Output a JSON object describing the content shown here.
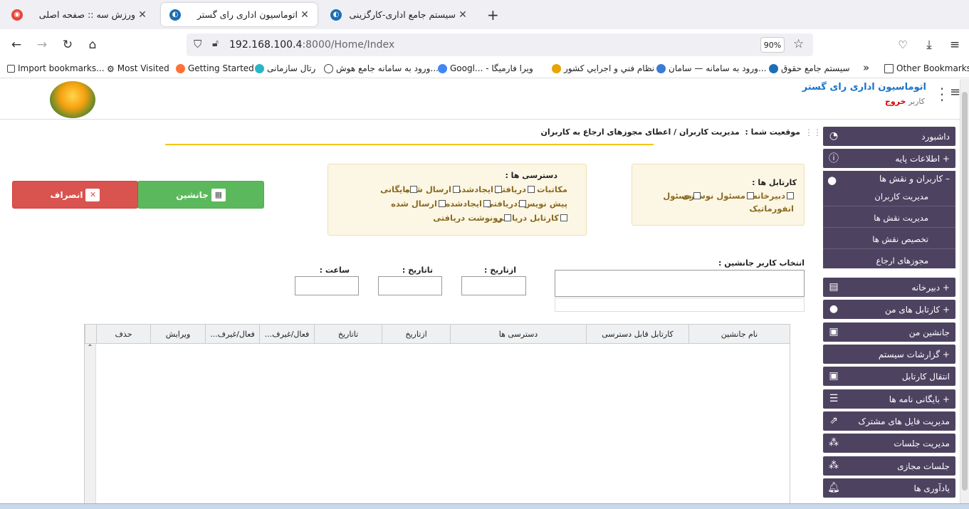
{
  "browser": {
    "tabs": [
      {
        "title": "ورزش سه :: صفحه اصلی",
        "active": false
      },
      {
        "title": "اتوماسیون اداری رای گستر",
        "active": true
      },
      {
        "title": "سیستم جامع اداری-کارگزینی",
        "active": false
      }
    ],
    "new_tab": "+",
    "url_host": "192.168.100.4",
    "url_rest": ":8000/Home/Index",
    "zoom": "90%",
    "bookmarks": [
      "Import bookmarks...",
      "Most Visited",
      "Getting Started",
      "رتال سازمانی",
      "ورود به سامانه جامع هوش...",
      "Googl... - ویرا فارمیگا",
      "نظام فني و اجرايي كشور",
      "ورود به سامانه — سامان...",
      "سیستم جامع حقوق",
      "Other Bookmarks"
    ]
  },
  "header": {
    "app_title": "اتوماسیون اداری رای گستر",
    "user_prefix": "کاربر",
    "logout": "خروج"
  },
  "sidebar": {
    "items": [
      {
        "label": "داشبورد",
        "icon": "dashboard-icon"
      },
      {
        "label": "+ اطلاعات پایه",
        "icon": "info-icon"
      },
      {
        "label": "+ دبیرخانه",
        "icon": "document-icon"
      },
      {
        "label": "+ کارتابل های من",
        "icon": "user-icon"
      },
      {
        "label": "جانشین من",
        "icon": "substitute-icon"
      },
      {
        "label": "+ گزارشات سیستم",
        "icon": ""
      },
      {
        "label": "انتقال کارتابل",
        "icon": "transfer-icon"
      },
      {
        "label": "+ بایگانی نامه ها",
        "icon": "archive-icon"
      },
      {
        "label": "مدیریت فایل های مشترک",
        "icon": "share-icon"
      },
      {
        "label": "مدیریت جلسات",
        "icon": "meeting-icon"
      },
      {
        "label": "جلسات مجازی",
        "icon": "virtual-meeting-icon"
      },
      {
        "label": "یادآوری ها",
        "icon": "bell-icon"
      }
    ],
    "group": {
      "label": "– کاربران و نقش ها",
      "subitems": [
        "مدیریت کاربران",
        "مدیریت نقش ها",
        "تخصیص نقش ها",
        "مجوزهای ارجاع"
      ]
    }
  },
  "breadcrumb": {
    "prefix": "موقعیت شما :",
    "path": "مدیریت کاربران / اعطای مجوزهای ارجاع به کاربران"
  },
  "form": {
    "kartable_title": "کارتابل ها :",
    "kartable_options": [
      "دبیرخانه",
      "مسئول نوسازی",
      "مسئول",
      "انفورماتیک"
    ],
    "access_title": "دسترسی ها :",
    "makatebat_label": "مکاتبات :",
    "makatebat_options": [
      "دریافتی",
      "ایجادشده",
      "ارسال شده",
      "بایگانی"
    ],
    "pishnevis_label": "پیش نویس :",
    "pishnevis_options": [
      "دریافتی",
      "ایجادشده",
      "ارسال شده"
    ],
    "other_options": [
      "کارتابل دریافتی",
      "رونوشت دریافتی"
    ],
    "save_label": "جانشین",
    "cancel_label": "انصراف",
    "substitute_label": "انتخاب کاربر جانشین :",
    "from_date_label": "ازتاریخ :",
    "to_date_label": "تاتاریخ :",
    "time_label": "ساعت :"
  },
  "table": {
    "columns": [
      "نام جانشین",
      "کارتابل قابل دسترسی",
      "دسترسی ها",
      "ازتاریخ",
      "تاتاریخ",
      "فعال/غیرف...",
      "فعال/غیرف...",
      "ویرایش",
      "حذف"
    ],
    "rows": []
  }
}
